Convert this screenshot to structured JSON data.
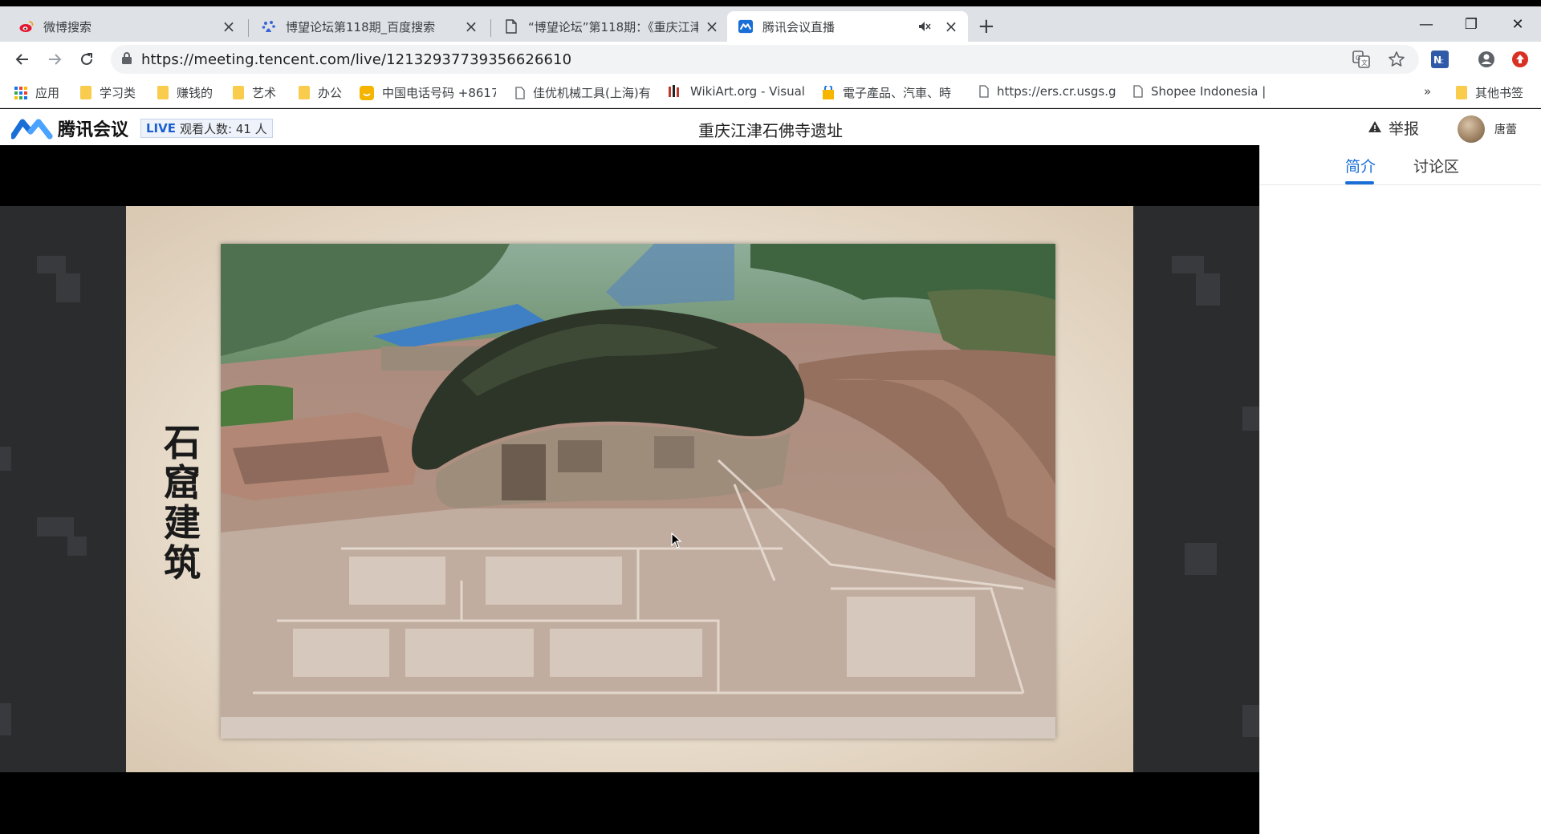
{
  "browser": {
    "tabs": [
      {
        "title": "微博搜索",
        "icon": "weibo-icon",
        "active": false
      },
      {
        "title": "博望论坛第118期_百度搜索",
        "icon": "baidu-paw-icon",
        "active": false
      },
      {
        "title": "“博望论坛”第118期：《重庆江津",
        "icon": "page-icon",
        "active": false
      },
      {
        "title": "腾讯会议直播",
        "icon": "tencent-meeting-icon",
        "active": true,
        "muted": true
      }
    ],
    "url": "https://meeting.tencent.com/live/12132937739356626610",
    "bookmarks": [
      {
        "label": "应用",
        "icon": "apps-grid-icon"
      },
      {
        "label": "学习类",
        "icon": "folder-icon"
      },
      {
        "label": "赚钱的",
        "icon": "folder-icon"
      },
      {
        "label": "艺术",
        "icon": "folder-icon"
      },
      {
        "label": "办公",
        "icon": "folder-icon"
      },
      {
        "label": "中国电话号码 +8617",
        "icon": "smile-icon"
      },
      {
        "label": "佳优机械工具(上海)有",
        "icon": "page-icon"
      },
      {
        "label": "WikiArt.org - Visual",
        "icon": "wikiart-icon"
      },
      {
        "label": "電子產品、汽車、時",
        "icon": "shopping-bag-icon"
      },
      {
        "label": "https://ers.cr.usgs.g",
        "icon": "page-icon"
      },
      {
        "label": "Shopee Indonesia |",
        "icon": "page-icon"
      }
    ],
    "bookmarks_overflow": "»",
    "other_bookmarks": "其他书签",
    "window_controls": {
      "minimize": "—",
      "restore": "❐",
      "close": "✕"
    }
  },
  "header": {
    "brand": "腾讯会议",
    "live_label": "LIVE",
    "viewers": "观看人数: 41 人",
    "title": "重庆江津石佛寺遗址",
    "report": "举报",
    "username": "唐蕾"
  },
  "slide": {
    "caption": "石窟建筑"
  },
  "panel": {
    "tabs": [
      {
        "label": "简介",
        "active": true
      },
      {
        "label": "讨论区",
        "active": false
      }
    ]
  },
  "colors": {
    "accent": "#1a6fd6",
    "tabstrip": "#dee1e6",
    "omnibox": "#f1f3f4",
    "folder": "#f9cc4e"
  }
}
